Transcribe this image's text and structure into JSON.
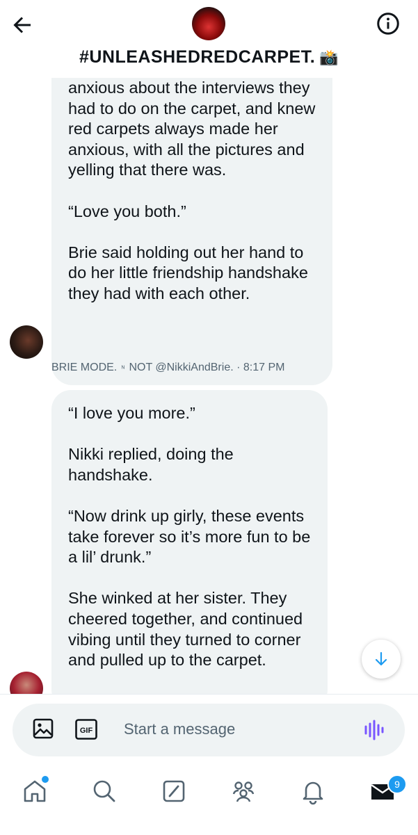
{
  "header": {
    "title": "#UNLEASHEDREDCARPET.",
    "title_emoji": "📸",
    "back_icon": "arrow-left-icon",
    "info_icon": "info-circle-icon"
  },
  "messages": [
    {
      "sender": "BRIE MODE.",
      "sender_verified_symbol": "ᴺ",
      "sender_handle_prefix": "NOT @NikkiAndBrie.",
      "time": "· 8:17 PM",
      "paragraphs": [
        "anxious about the interviews they had to do on the carpet, and knew red carpets always made her anxious, with all the pictures and yelling that there was.",
        "“Love you both.”",
        "Brie said holding out her hand to do her little friendship handshake they had with each other."
      ]
    },
    {
      "paragraphs": [
        "“I love you more.”",
        "Nikki replied, doing the handshake.",
        "“Now drink up girly, these events take forever so it’s more fun to be a lil’ drunk.”",
        "She winked at her sister. They cheered together, and continued vibing until they turned to corner and pulled up to the carpet."
      ]
    }
  ],
  "composer": {
    "placeholder": "Start a message",
    "gif_label": "GIF"
  },
  "nav": {
    "items": [
      "home-icon",
      "search-icon",
      "grok-icon",
      "communities-icon",
      "notifications-icon",
      "messages-icon"
    ],
    "messages_badge": "9"
  },
  "colors": {
    "accent": "#1d9bf0",
    "bubble": "#eff3f4",
    "voice": "#7856ff"
  }
}
